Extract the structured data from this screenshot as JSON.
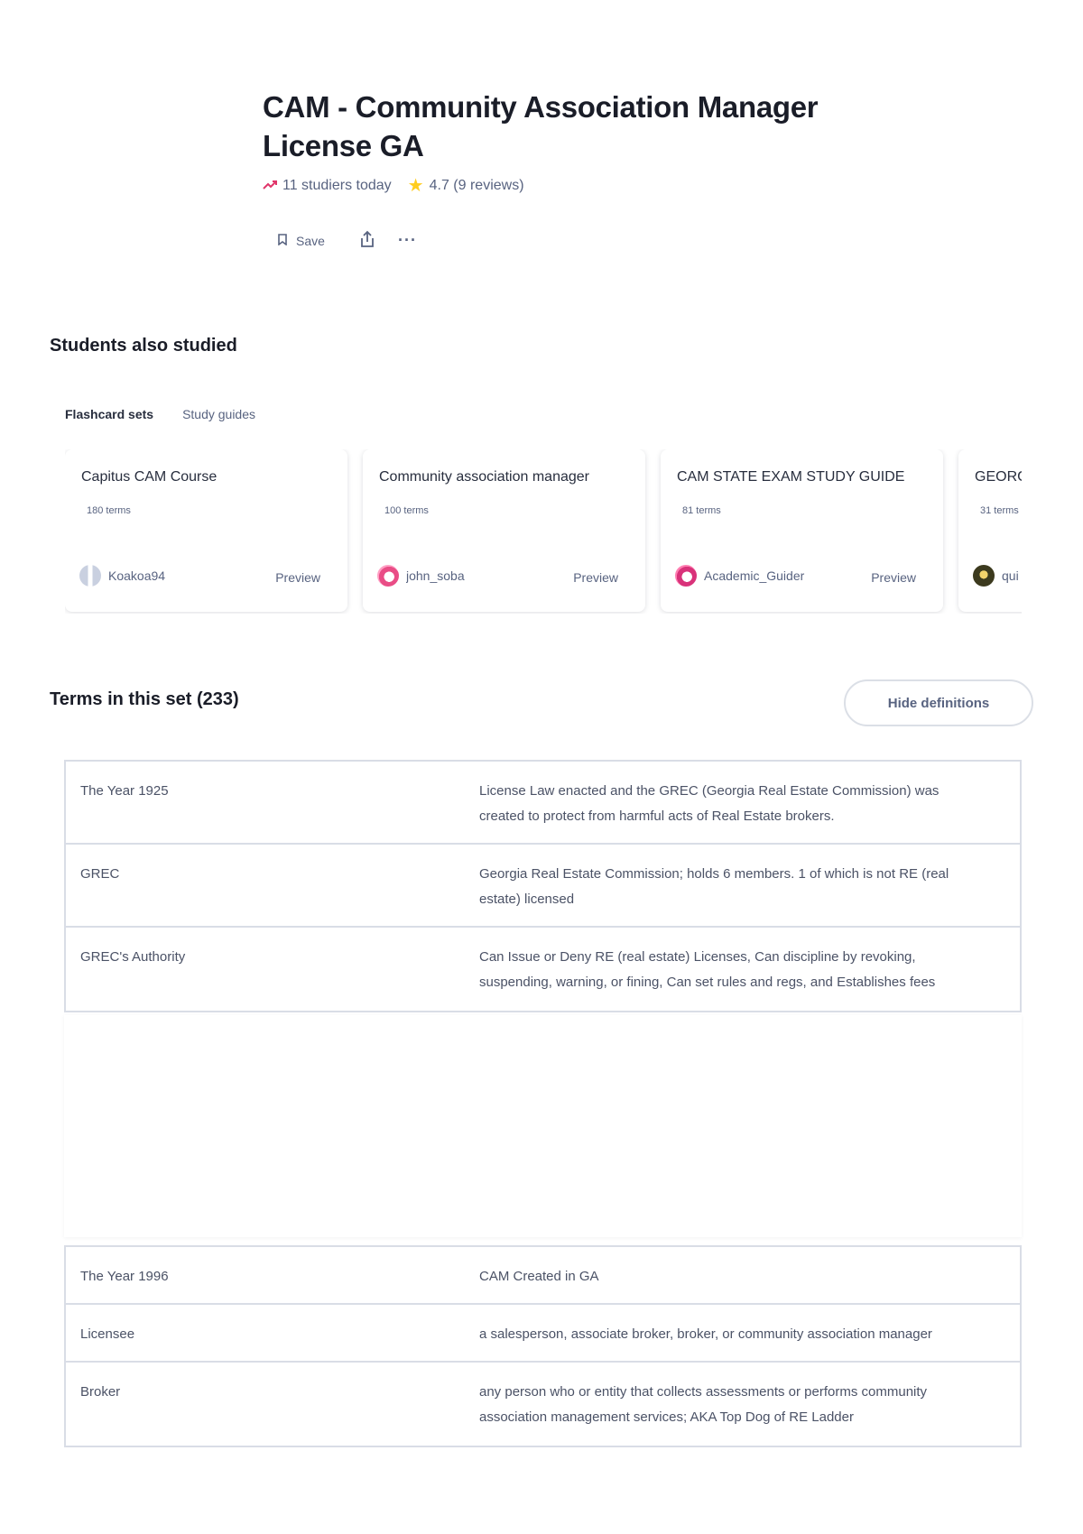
{
  "set": {
    "title": "CAM - Community Association Manager License GA",
    "studiers": "11 studiers today",
    "rating": "4.7 (9 reviews)"
  },
  "actions": {
    "save_label": "Save",
    "share_icon": "share-icon",
    "more_label": "···"
  },
  "also_studied": {
    "heading": "Students also studied",
    "tabs": [
      "Flashcard sets",
      "Study guides"
    ],
    "cards": [
      {
        "title": "Capitus CAM Course",
        "terms": "180 terms",
        "author": "Koakoa94",
        "preview": "Preview"
      },
      {
        "title": "Community association manager",
        "terms": "100 terms",
        "author": "john_soba",
        "preview": "Preview"
      },
      {
        "title": "CAM STATE EXAM STUDY GUIDE",
        "terms": "81 terms",
        "author": "Academic_Guider",
        "preview": "Preview"
      },
      {
        "title": "GEORG",
        "terms": "31 terms",
        "author": "qui",
        "preview": ""
      }
    ]
  },
  "terms_section": {
    "heading": "Terms in this set (233)",
    "hide_button": "Hide definitions",
    "rows_top": [
      {
        "term": "The Year 1925",
        "definition": "License Law enacted and the GREC (Georgia Real Estate Commission) was created to protect from harmful acts of Real Estate brokers."
      },
      {
        "term": "GREC",
        "definition": "Georgia Real Estate Commission; holds 6 members. 1 of which is not RE (real estate) licensed"
      },
      {
        "term": "GREC's Authority",
        "definition": "Can Issue or Deny RE (real estate) Licenses, Can discipline by revoking, suspending, warning, or fining, Can set rules and regs, and Establishes fees"
      }
    ],
    "rows_bottom": [
      {
        "term": "The Year 1996",
        "definition": "CAM Created in GA"
      },
      {
        "term": "Licensee",
        "definition": "a salesperson, associate broker, broker, or community association manager"
      },
      {
        "term": "Broker",
        "definition": "any person who or entity that collects assessments or performs community association management services; AKA Top Dog of RE Ladder"
      }
    ]
  },
  "colors": {
    "text_primary": "#1a1d28",
    "text_secondary": "#586380",
    "border": "#d9dde6",
    "trend_accent": "#e0356a",
    "star": "#ffcd1f"
  }
}
